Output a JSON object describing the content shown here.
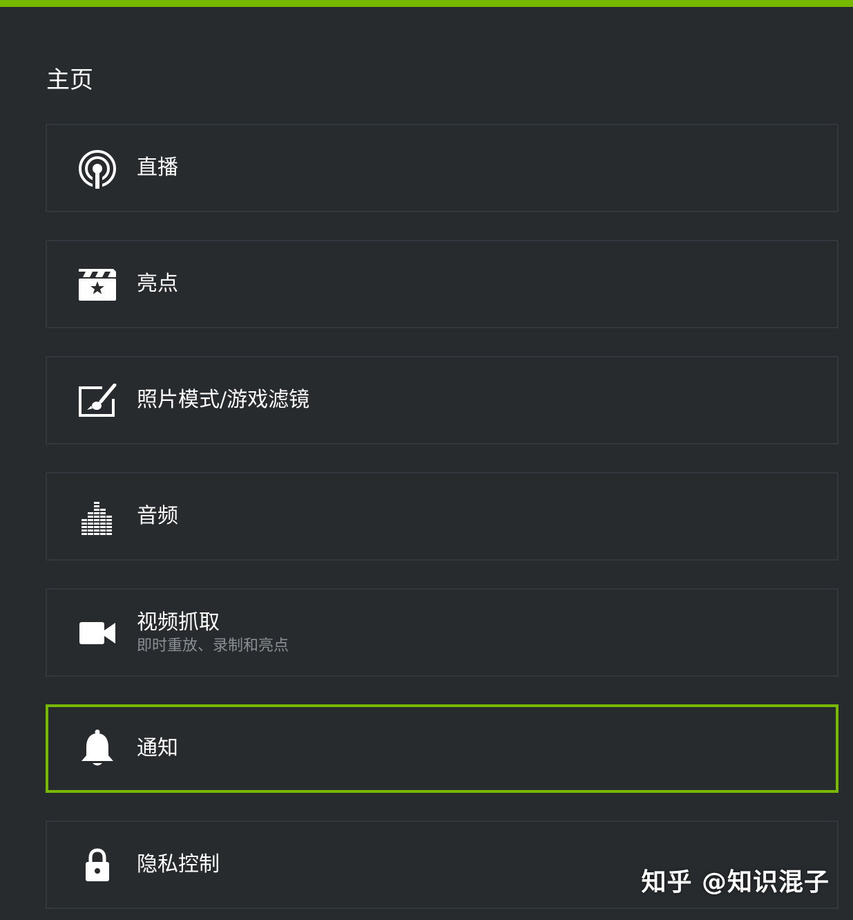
{
  "header": {
    "title": "主页",
    "accent_color": "#76b900"
  },
  "menu": {
    "items": [
      {
        "label": "直播",
        "sublabel": "",
        "icon": "broadcast-icon",
        "selected": false
      },
      {
        "label": "亮点",
        "sublabel": "",
        "icon": "highlights-icon",
        "selected": false
      },
      {
        "label": "照片模式/游戏滤镜",
        "sublabel": "",
        "icon": "photo-mode-icon",
        "selected": false
      },
      {
        "label": "音频",
        "sublabel": "",
        "icon": "audio-equalizer-icon",
        "selected": false
      },
      {
        "label": "视频抓取",
        "sublabel": "即时重放、录制和亮点",
        "icon": "video-camera-icon",
        "selected": false
      },
      {
        "label": "通知",
        "sublabel": "",
        "icon": "bell-icon",
        "selected": true
      },
      {
        "label": "隐私控制",
        "sublabel": "",
        "icon": "lock-icon",
        "selected": false
      }
    ]
  },
  "watermark": {
    "text": "知乎 @知识混子"
  }
}
